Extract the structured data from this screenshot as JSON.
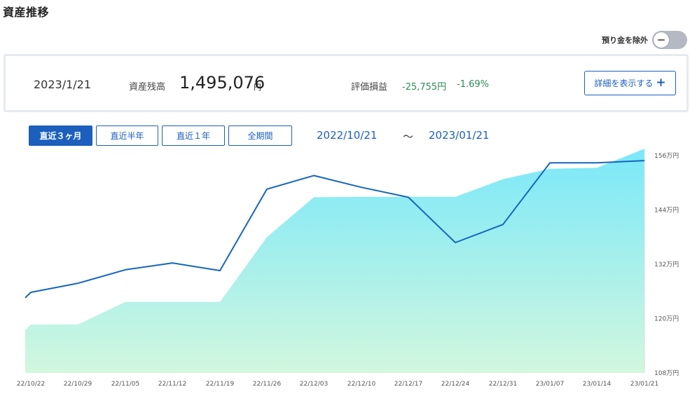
{
  "page_title": "資産推移",
  "toggle": {
    "label": "預り金を除外",
    "state": "off"
  },
  "summary": {
    "date": "2023/1/21",
    "balance_label": "資産残高",
    "balance": "1,495,076",
    "balance_unit": "円",
    "pl_label": "評価損益",
    "pl_value": "-25,755円",
    "pl_percent": "-1.69%",
    "detail_button": "詳細を表示する",
    "detail_icon": "plus-icon"
  },
  "tabs": [
    {
      "label": "直近３ヶ月",
      "active": true
    },
    {
      "label": "直近半年",
      "active": false
    },
    {
      "label": "直近１年",
      "active": false
    },
    {
      "label": "全期間",
      "active": false
    }
  ],
  "range": {
    "start": "2022/10/21",
    "separator": "～",
    "end": "2023/01/21"
  },
  "colors": {
    "accent": "#1c5fbd",
    "line": "#1565c0",
    "area_top": "#7ae8f9",
    "area_bottom": "#d2f7de",
    "gain_loss": "#2e8b57"
  },
  "chart_data": {
    "type": "line",
    "x": [
      "22/10/21",
      "22/10/22",
      "22/10/29",
      "22/11/05",
      "22/11/12",
      "22/11/19",
      "22/11/26",
      "22/12/03",
      "22/12/10",
      "22/12/17",
      "22/12/24",
      "22/12/31",
      "23/01/07",
      "23/01/14",
      "23/01/21"
    ],
    "x_tick_labels": [
      "22/10/22",
      "22/10/29",
      "22/11/05",
      "22/11/12",
      "22/11/19",
      "22/11/26",
      "22/12/03",
      "22/12/10",
      "22/12/17",
      "22/12/24",
      "22/12/31",
      "23/01/07",
      "23/01/14",
      "23/01/21"
    ],
    "series": [
      {
        "kind": "line",
        "values": [
          1246000,
          1258000,
          1278000,
          1308000,
          1323000,
          1306000,
          1486000,
          1516000,
          1490000,
          1468000,
          1368000,
          1408000,
          1544000,
          1544000,
          1549000
        ]
      },
      {
        "kind": "area",
        "values": [
          1175000,
          1187000,
          1187000,
          1237000,
          1237000,
          1237000,
          1380000,
          1468000,
          1469000,
          1469000,
          1469000,
          1508000,
          1531000,
          1533000,
          1575000
        ]
      }
    ],
    "y_tick_labels": [
      "156万円",
      "144万円",
      "132万円",
      "120万円",
      "108万円"
    ],
    "y_ticks": [
      1560000,
      1440000,
      1320000,
      1200000,
      1080000
    ],
    "ylim": [
      1080000,
      1560000
    ],
    "y_axis_side": "right",
    "grid": false,
    "legend": "none"
  }
}
